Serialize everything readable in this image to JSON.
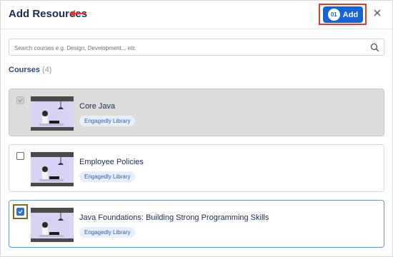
{
  "header": {
    "title": "Add Resources",
    "add_button": {
      "count": "01",
      "label": "Add"
    }
  },
  "search": {
    "placeholder": "Search courses e.g. Design, Development... etc"
  },
  "section": {
    "label": "Courses",
    "count": "(4)"
  },
  "courses": [
    {
      "title": "Core Java",
      "badge": "Engagedly Library",
      "state": "disabled"
    },
    {
      "title": "Employee Policies",
      "badge": "Engagedly Library",
      "state": "unchecked"
    },
    {
      "title": "Java Foundations: Building Strong Programming Skills",
      "badge": "Engagedly Library",
      "state": "checked"
    }
  ],
  "colors": {
    "accent": "#1565d8",
    "highlight": "#e23a2e"
  },
  "icons": [
    "left-arrow-icon",
    "close-icon",
    "search-icon",
    "checkmark-icon"
  ]
}
